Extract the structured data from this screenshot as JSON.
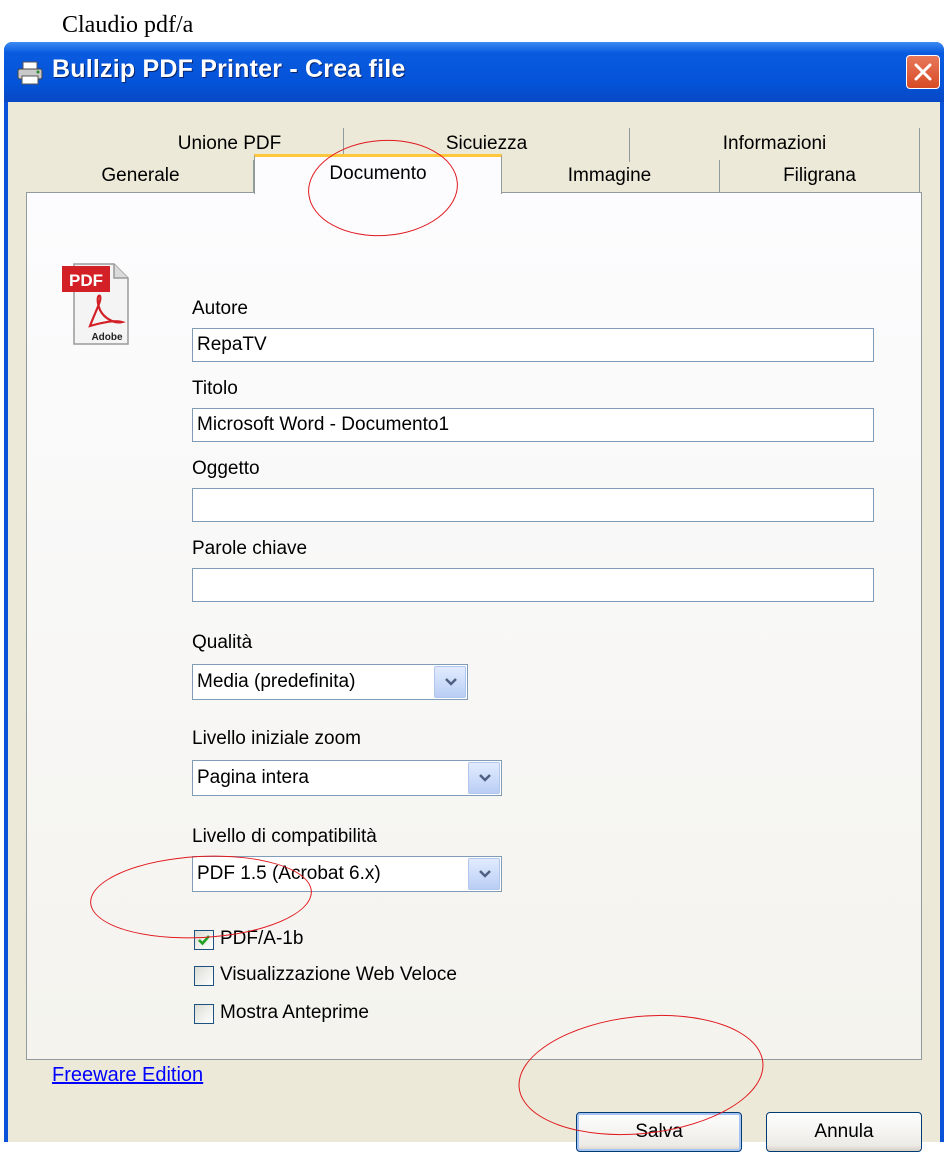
{
  "caption": "Claudio pdf/a",
  "window": {
    "title": "Bullzip PDF Printer - Crea file"
  },
  "tabs": {
    "row1": [
      "Unione PDF",
      "Sicuiezza",
      "Informazioni"
    ],
    "row2": [
      "Generale",
      "Documento",
      "Immagine",
      "Filigrana"
    ],
    "active": "Documento"
  },
  "document": {
    "author_label": "Autore",
    "author_value": "RepaTV",
    "title_label": "Titolo",
    "title_value": "Microsoft Word - Documento1",
    "subject_label": "Oggetto",
    "subject_value": "",
    "keywords_label": "Parole chiave",
    "keywords_value": "",
    "quality_label": "Qualità",
    "quality_value": "Media (predefinita)",
    "zoom_label": "Livello iniziale zoom",
    "zoom_value": "Pagina intera",
    "compat_label": "Livello di compatibilità",
    "compat_value": "PDF 1.5 (Acrobat 6.x)",
    "checkboxes": [
      {
        "label": "PDF/A-1b",
        "checked": true
      },
      {
        "label": "Visualizzazione Web Veloce",
        "checked": false
      },
      {
        "label": "Mostra Anteprime",
        "checked": false
      }
    ]
  },
  "pdf_icon": {
    "badge": "PDF",
    "brand": "Adobe"
  },
  "footer": {
    "link": "Freeware Edition",
    "save": "Salva",
    "cancel": "Annula"
  },
  "icons": [
    "printer-icon",
    "close-icon",
    "pdf-file-icon",
    "dropdown-arrow-icon",
    "checkmark-icon"
  ]
}
